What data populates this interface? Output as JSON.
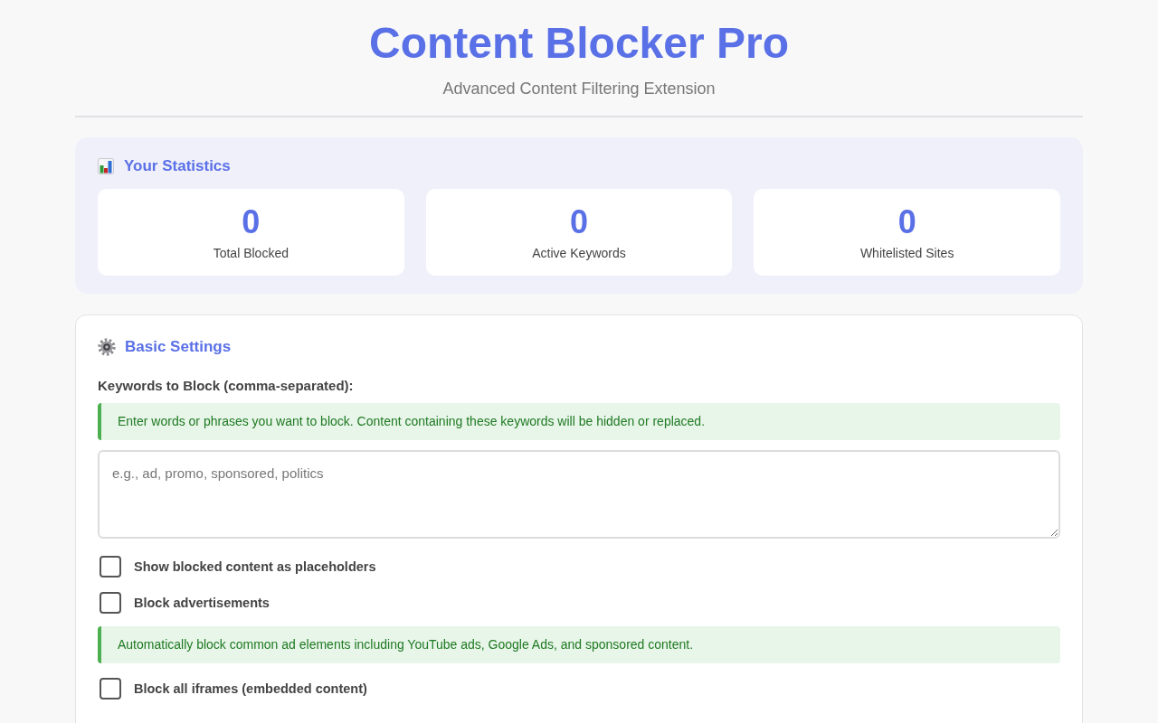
{
  "header": {
    "title": "Content Blocker Pro",
    "subtitle": "Advanced Content Filtering Extension"
  },
  "statistics": {
    "heading": "Your Statistics",
    "stats": [
      {
        "value": "0",
        "label": "Total Blocked"
      },
      {
        "value": "0",
        "label": "Active Keywords"
      },
      {
        "value": "0",
        "label": "Whitelisted Sites"
      }
    ]
  },
  "settings": {
    "heading": "Basic Settings",
    "items": [
      {
        "kind": "label",
        "text": "Keywords to Block (comma-separated):"
      },
      {
        "kind": "note",
        "text": "Enter words or phrases you want to block. Content containing these keywords will be hidden or replaced."
      },
      {
        "kind": "textarea",
        "placeholder": "e.g., ad, promo, sponsored, politics"
      },
      {
        "kind": "checkbox",
        "label": "Show blocked content as placeholders",
        "checked": false
      },
      {
        "kind": "checkbox",
        "label": "Block advertisements",
        "checked": false
      },
      {
        "kind": "note",
        "text": "Automatically block common ad elements including YouTube ads, Google Ads, and sponsored content."
      },
      {
        "kind": "checkbox",
        "label": "Block all iframes (embedded content)",
        "checked": false
      }
    ]
  }
}
